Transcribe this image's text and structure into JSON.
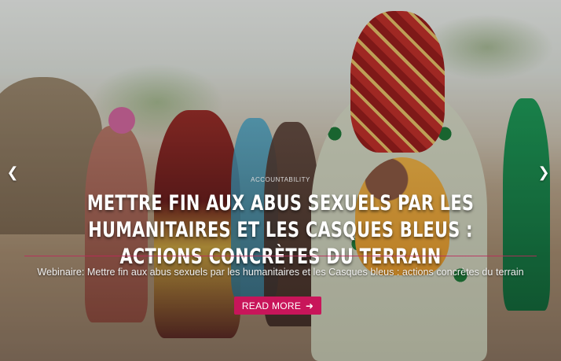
{
  "slide": {
    "category": "ACCOUNTABILITY",
    "title": "METTRE FIN AUX ABUS SEXUELS PAR LES HUMANITAIRES ET LES CASQUES BLEUS : ACTIONS CONCRÈTES DU TERRAIN",
    "subtitle": "Webinaire: Mettre fin aux abus sexuels par les humanitaires et les Casques bleus : actions concrètes du terrain",
    "cta_label": "READ MORE",
    "cta_icon": "arrow-right-icon",
    "prev_icon": "chevron-left-icon",
    "next_icon": "chevron-right-icon"
  },
  "colors": {
    "accent": "#c8155a",
    "title_text": "#ffffff"
  }
}
